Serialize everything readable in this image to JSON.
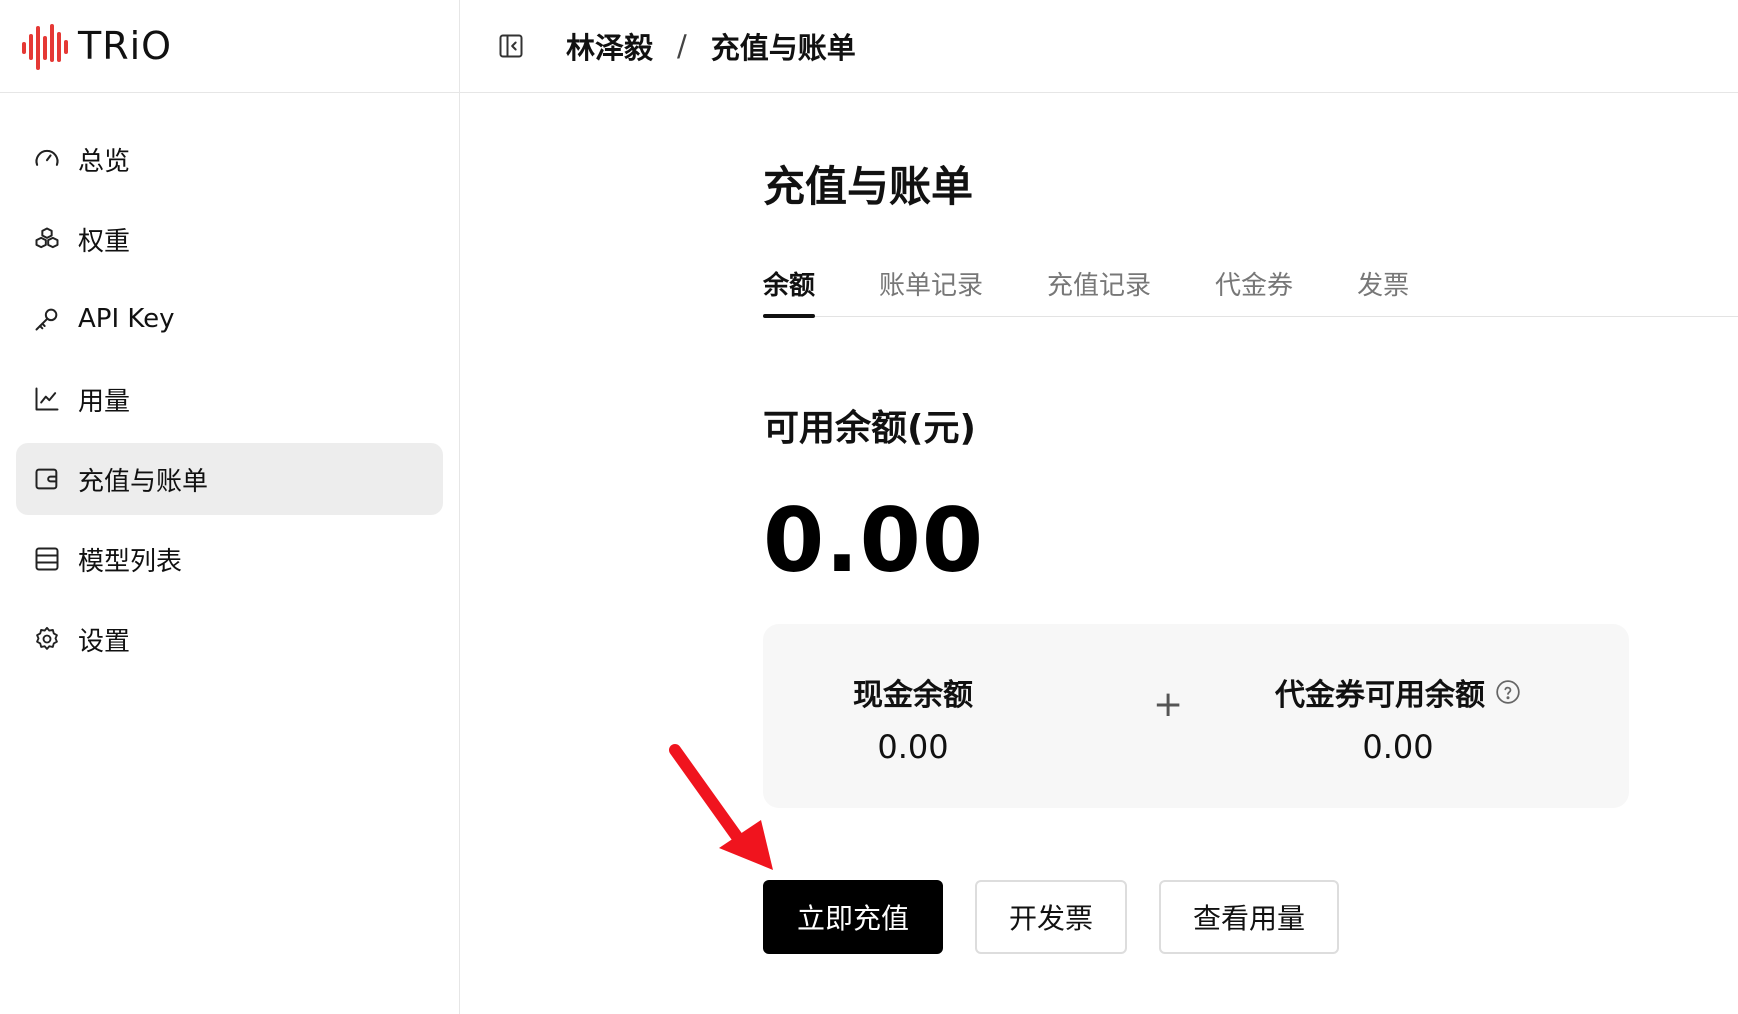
{
  "brand": {
    "name": "TRiO",
    "accent": "#e53935"
  },
  "sidebar": {
    "items": [
      {
        "label": "总览",
        "icon": "gauge-icon",
        "active": false
      },
      {
        "label": "权重",
        "icon": "boxes-icon",
        "active": false
      },
      {
        "label": "API Key",
        "icon": "key-icon",
        "active": false
      },
      {
        "label": "用量",
        "icon": "line-chart-icon",
        "active": false
      },
      {
        "label": "充值与账单",
        "icon": "wallet-icon",
        "active": true
      },
      {
        "label": "模型列表",
        "icon": "list-icon",
        "active": false
      },
      {
        "label": "设置",
        "icon": "gear-icon",
        "active": false
      }
    ]
  },
  "breadcrumb": {
    "user": "林泽毅",
    "separator": "/",
    "page": "充值与账单"
  },
  "main": {
    "title": "充值与账单",
    "tabs": [
      {
        "label": "余额",
        "active": true
      },
      {
        "label": "账单记录",
        "active": false
      },
      {
        "label": "充值记录",
        "active": false
      },
      {
        "label": "代金券",
        "active": false
      },
      {
        "label": "发票",
        "active": false
      }
    ],
    "balance": {
      "label": "可用余额(元)",
      "value": "0.00"
    },
    "breakdown": {
      "cash_label": "现金余额",
      "cash_value": "0.00",
      "plus": "+",
      "voucher_label": "代金券可用余额",
      "voucher_value": "0.00"
    },
    "actions": {
      "recharge": "立即充值",
      "invoice": "开发票",
      "usage": "查看用量"
    }
  },
  "annotation": {
    "arrow_color": "#f0141e"
  }
}
